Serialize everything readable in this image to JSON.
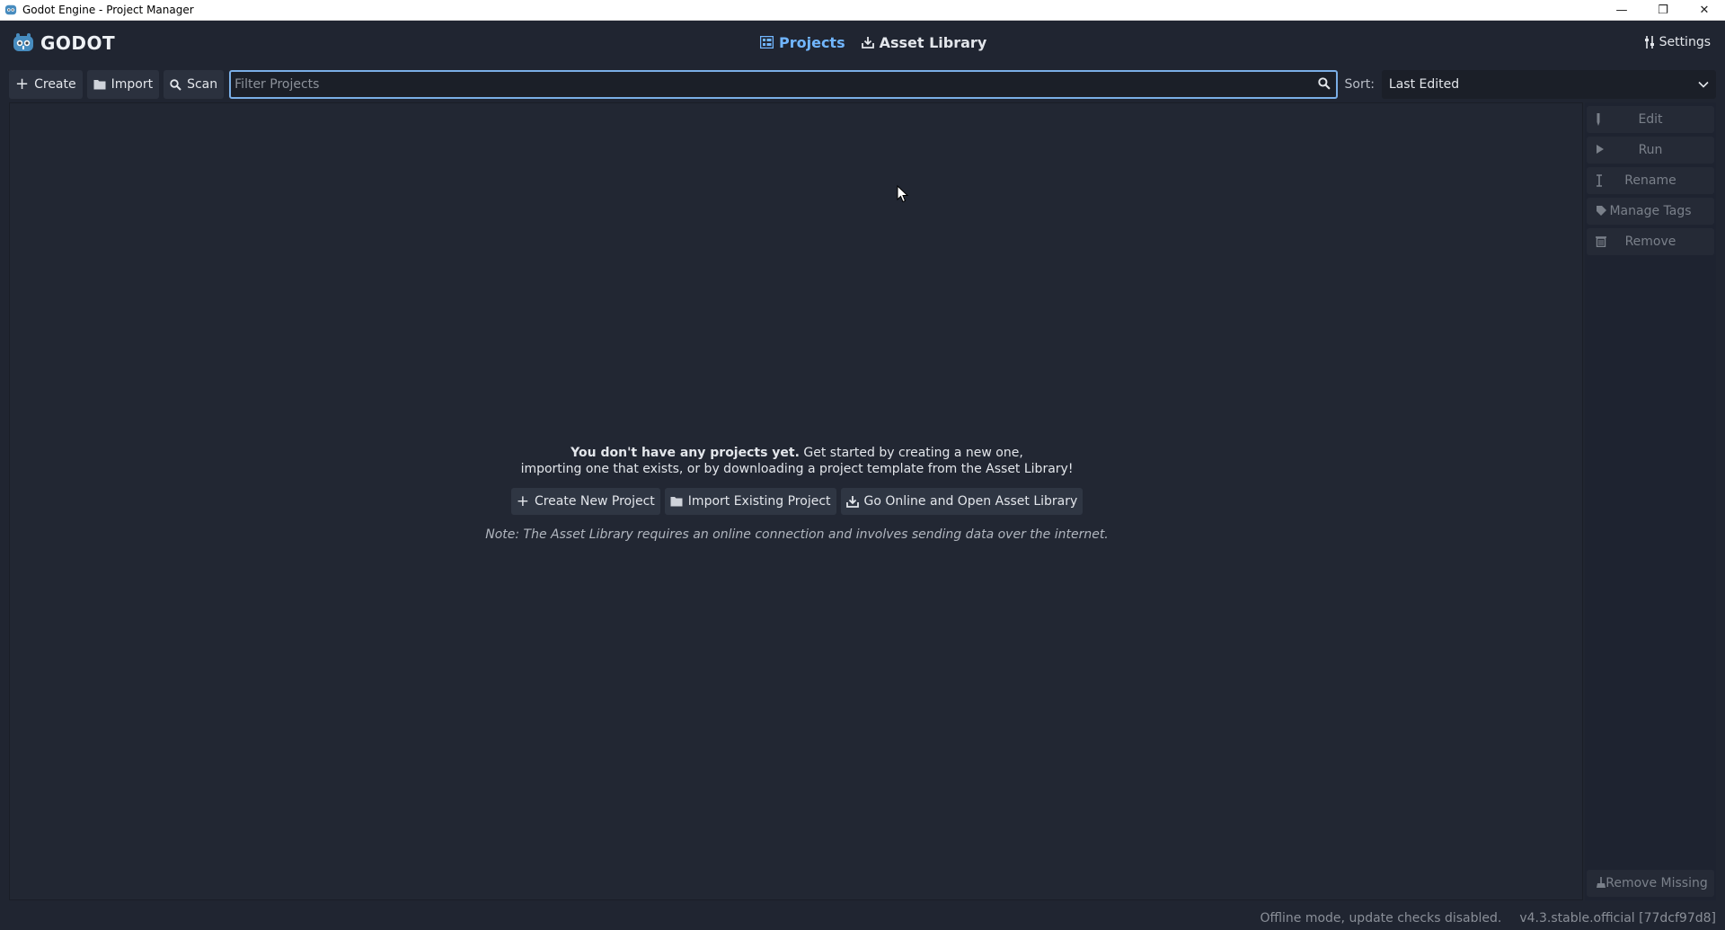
{
  "window": {
    "title": "Godot Engine - Project Manager",
    "controls": {
      "minimize": "—",
      "maximize": "❐",
      "close": "✕"
    }
  },
  "header": {
    "logo_text": "GODOT",
    "tabs": [
      {
        "label": "Projects",
        "active": true,
        "icon": "projects-icon"
      },
      {
        "label": "Asset Library",
        "active": false,
        "icon": "download-icon"
      }
    ],
    "settings_label": "Settings"
  },
  "toolbar": {
    "create_label": "Create",
    "import_label": "Import",
    "scan_label": "Scan",
    "filter_placeholder": "Filter Projects",
    "filter_value": "",
    "sort_label": "Sort:",
    "sort_value": "Last Edited"
  },
  "empty_state": {
    "bold_text": "You don't have any projects yet.",
    "line1_rest": " Get started by creating a new one,",
    "line2": "importing one that exists, or by downloading a project template from the Asset Library!",
    "create_button": "Create New Project",
    "import_button": "Import Existing Project",
    "online_button": "Go Online and Open Asset Library",
    "note": "Note: The Asset Library requires an online connection and involves sending data over the internet."
  },
  "sidebar": {
    "items": [
      {
        "label": "Edit",
        "icon": "edit-icon"
      },
      {
        "label": "Run",
        "icon": "play-icon"
      },
      {
        "label": "Rename",
        "icon": "rename-icon"
      },
      {
        "label": "Manage Tags",
        "icon": "tag-icon"
      },
      {
        "label": "Remove",
        "icon": "trash-icon"
      }
    ],
    "remove_missing": "Remove Missing"
  },
  "status": {
    "offline": "Offline mode, update checks disabled.",
    "version": "v4.3.stable.official [77dcf97d8]"
  },
  "colors": {
    "background": "#202531",
    "accent": "#71b6ff",
    "panel": "#222733",
    "button": "#2f3643"
  }
}
